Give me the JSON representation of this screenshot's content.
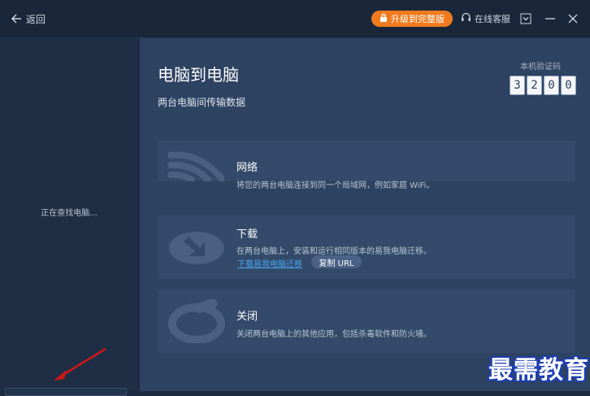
{
  "header": {
    "back_label": "返回",
    "upgrade_label": "升级到完整版",
    "support_label": "在线客服"
  },
  "left": {
    "status": "正在查找电脑..."
  },
  "main": {
    "title": "电脑到电脑",
    "subtitle": "两台电脑间传输数据",
    "code_label": "本机验证码",
    "code_digits": [
      "3",
      "2",
      "0",
      "0"
    ],
    "cards": [
      {
        "title": "网络",
        "desc": "将您的两台电脑连接到同一个局域网，例如家庭 WiFi。",
        "icon": "wifi-icon"
      },
      {
        "title": "下载",
        "desc": "在两台电脑上，安装和运行相同版本的易我电脑迁移。",
        "icon": "download-icon"
      },
      {
        "title": "关闭",
        "desc": "关闭两台电脑上的其他应用，包括杀毒软件和防火墙。",
        "icon": "power-icon"
      }
    ],
    "download_link": "下载易我电脑迁移",
    "copy_url_label": "复制 URL"
  },
  "watermark": "最需教育",
  "colors": {
    "accent": "#f07b1e",
    "link": "#47a6f2",
    "panel": "#2e4262",
    "card": "#344a6a"
  }
}
